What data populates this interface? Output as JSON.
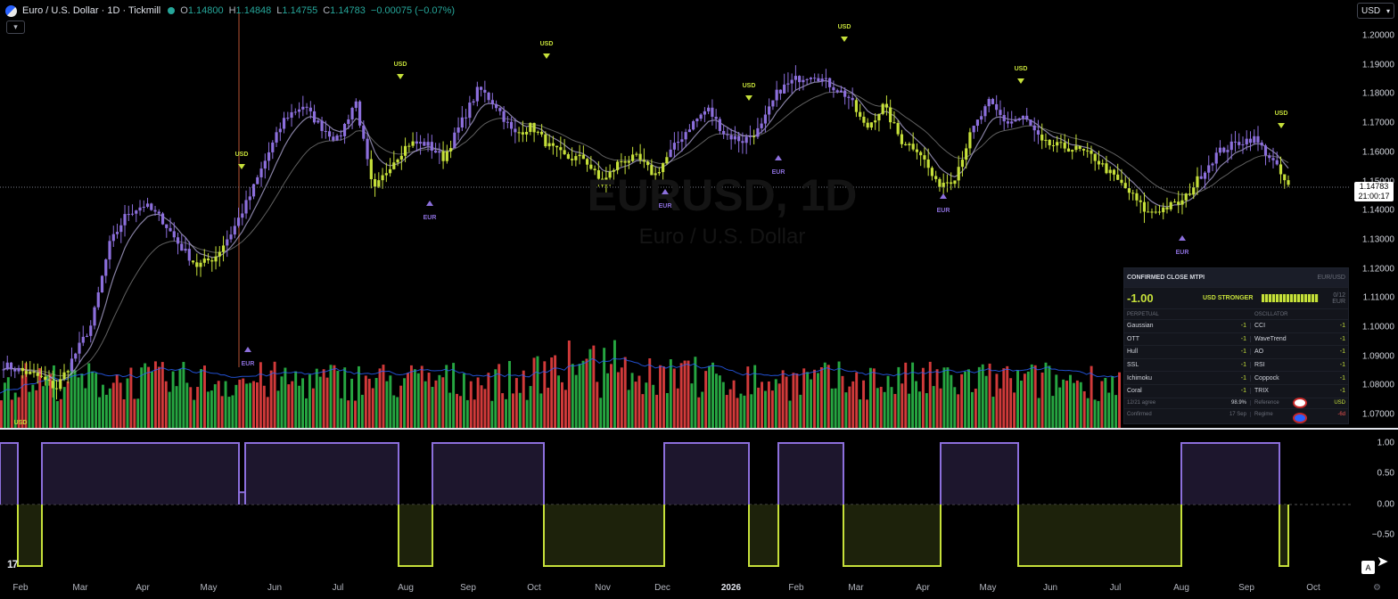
{
  "header": {
    "title": "Euro / U.S. Dollar · 1D · Tickmill",
    "ohlc": [
      {
        "label": "O",
        "value": "1.14800"
      },
      {
        "label": "H",
        "value": "1.14848"
      },
      {
        "label": "L",
        "value": "1.14755"
      },
      {
        "label": "C",
        "value": "1.14783"
      }
    ],
    "change": "−0.00075 (−0.07%)",
    "collapse_icon": "chevron-down-icon"
  },
  "currency_select": {
    "value": "USD"
  },
  "price_scale": {
    "labels": [
      "1.20000",
      "1.19000",
      "1.18000",
      "1.17000",
      "1.16000",
      "1.15000",
      "1.14000",
      "1.13000",
      "1.12000",
      "1.11000",
      "1.10000",
      "1.09000",
      "1.08000",
      "1.07000"
    ],
    "last_price": "1.14783",
    "countdown": "21:00:17"
  },
  "watermark": {
    "symbol": "EURUSD, 1D",
    "description": "Euro / U.S. Dollar"
  },
  "indicator_scale": {
    "labels": [
      "1.00",
      "0.50",
      "0.00",
      "−0.50"
    ]
  },
  "signals": [
    {
      "text": "USD",
      "kind": "usd"
    },
    {
      "text": "USD",
      "kind": "usd"
    },
    {
      "text": "USD",
      "kind": "usd"
    },
    {
      "text": "USD",
      "kind": "usd"
    },
    {
      "text": "USD",
      "kind": "usd"
    },
    {
      "text": "USD",
      "kind": "usd"
    },
    {
      "text": "USD",
      "kind": "usd"
    },
    {
      "text": "EUR",
      "kind": "eur"
    },
    {
      "text": "EUR",
      "kind": "eur"
    },
    {
      "text": "EUR",
      "kind": "eur"
    },
    {
      "text": "EUR",
      "kind": "eur"
    },
    {
      "text": "EUR",
      "kind": "eur"
    },
    {
      "text": "EUR",
      "kind": "eur"
    },
    {
      "text": "USD",
      "kind": "usd"
    }
  ],
  "mtpi_table": {
    "title": "CONFIRMED CLOSE MTPI",
    "pair": "EUR/USD",
    "score": "-1.00",
    "state": "USD STRONGER",
    "gauge_text": "0/12 EUR",
    "col_left": "PERPETUAL",
    "col_right": "OSCILLATOR",
    "rows": [
      {
        "left": "Gaussian",
        "lv": "-1",
        "right": "CCI",
        "rv": "-1"
      },
      {
        "left": "OTT",
        "lv": "-1",
        "right": "WaveTrend",
        "rv": "-1"
      },
      {
        "left": "Hull",
        "lv": "-1",
        "right": "AO",
        "rv": "-1"
      },
      {
        "left": "SSL",
        "lv": "-1",
        "right": "RSI",
        "rv": "-1"
      },
      {
        "left": "Ichimoku",
        "lv": "-1",
        "right": "Coppock",
        "rv": "-1"
      },
      {
        "left": "Coral",
        "lv": "-1",
        "right": "TRIX",
        "rv": "-1"
      }
    ],
    "foot1": {
      "left": "12/21 agree",
      "lv": "98.9%",
      "right": "Reference",
      "rv": "USD"
    },
    "foot2": {
      "left": "Confirmed",
      "lv": "17 Sep",
      "right": "Regime",
      "rv": "-6d"
    }
  },
  "x_axis": {
    "labels": [
      "Feb",
      "Mar",
      "Apr",
      "May",
      "Jun",
      "Jul",
      "Aug",
      "Sep",
      "Oct",
      "Nov",
      "Dec",
      "2026",
      "Feb",
      "Mar",
      "Apr",
      "May",
      "Jun",
      "Jul",
      "Aug",
      "Sep",
      "Oct"
    ]
  },
  "bottom_controls": {
    "auto_label": "A",
    "tv_logo": "17"
  },
  "colors": {
    "eur": "#8c6fdc",
    "usd": "#c6e03a",
    "volume_up": "#26a641",
    "volume_down": "#d13a3a",
    "grid_line": "#787b86"
  },
  "chart_data": {
    "type": "line",
    "series": [
      {
        "values": [
          1.087,
          1.085,
          1.083,
          1.079,
          1.09,
          1.101,
          1.128,
          1.139,
          1.142,
          1.137,
          1.128,
          1.121,
          1.124,
          1.133,
          1.145,
          1.159,
          1.172,
          1.176,
          1.169,
          1.164,
          1.178,
          1.146,
          1.156,
          1.163,
          1.163,
          1.158,
          1.17,
          1.182,
          1.176,
          1.166,
          1.169,
          1.162,
          1.158,
          1.158,
          1.149,
          1.157,
          1.158,
          1.152,
          1.161,
          1.169,
          1.175,
          1.166,
          1.164,
          1.168,
          1.181,
          1.185,
          1.187,
          1.183,
          1.179,
          1.168,
          1.176,
          1.164,
          1.161,
          1.149,
          1.151,
          1.167,
          1.177,
          1.17,
          1.172,
          1.163,
          1.162,
          1.161,
          1.158,
          1.152,
          1.146,
          1.139,
          1.141,
          1.143,
          1.152,
          1.16,
          1.163,
          1.165,
          1.158,
          1.148
        ]
      }
    ],
    "ylim": [
      1.065,
      1.205
    ]
  }
}
